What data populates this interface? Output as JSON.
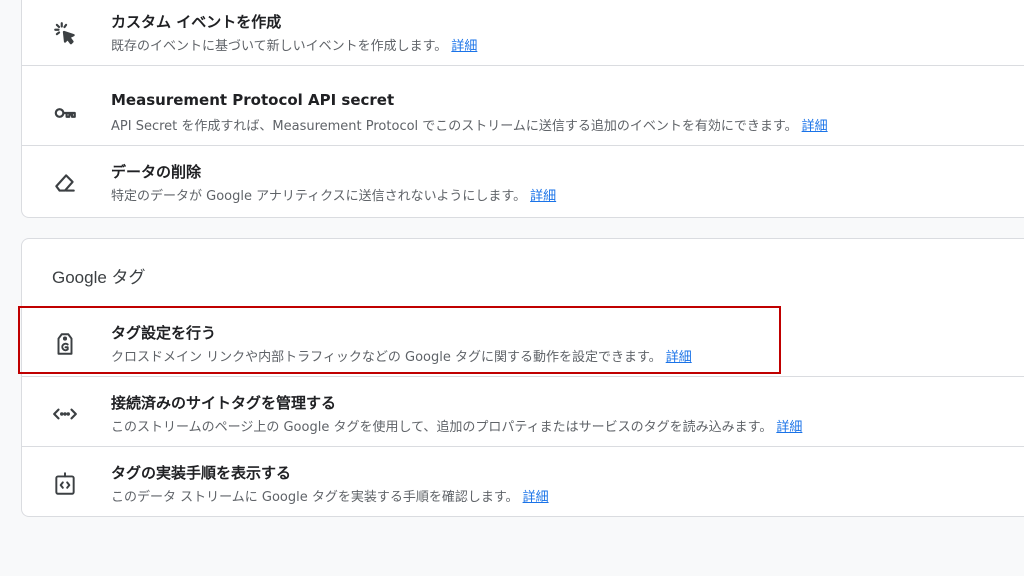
{
  "events_section": {
    "items": [
      {
        "icon": "cursor-click-icon",
        "title": "カスタム イベントを作成",
        "description": "既存のイベントに基づいて新しいイベントを作成します。",
        "link": "詳細"
      },
      {
        "icon": "key-icon",
        "title": "Measurement Protocol API secret",
        "description": "API Secret を作成すれば、Measurement Protocol でこのストリームに送信する追加のイベントを有効にできます。",
        "link": "詳細"
      },
      {
        "icon": "eraser-icon",
        "title": "データの削除",
        "description": "特定のデータが Google アナリティクスに送信されないようにします。",
        "link": "詳細"
      }
    ]
  },
  "google_tag_section": {
    "title": "Google タグ",
    "items": [
      {
        "icon": "tag-settings-icon",
        "title": "タグ設定を行う",
        "description": "クロスドメイン リンクや内部トラフィックなどの Google タグに関する動作を設定できます。",
        "link": "詳細",
        "highlighted": true
      },
      {
        "icon": "code-icon",
        "title": "接続済みのサイトタグを管理する",
        "description": "このストリームのページ上の Google タグを使用して、追加のプロパティまたはサービスのタグを読み込みます。",
        "link": "詳細"
      },
      {
        "icon": "install-code-icon",
        "title": "タグの実装手順を表示する",
        "description": "このデータ ストリームに Google タグを実装する手順を確認します。",
        "link": "詳細"
      }
    ]
  },
  "colors": {
    "link": "#1a73e8",
    "highlight_border": "#c00000",
    "divider": "#dadce0"
  }
}
